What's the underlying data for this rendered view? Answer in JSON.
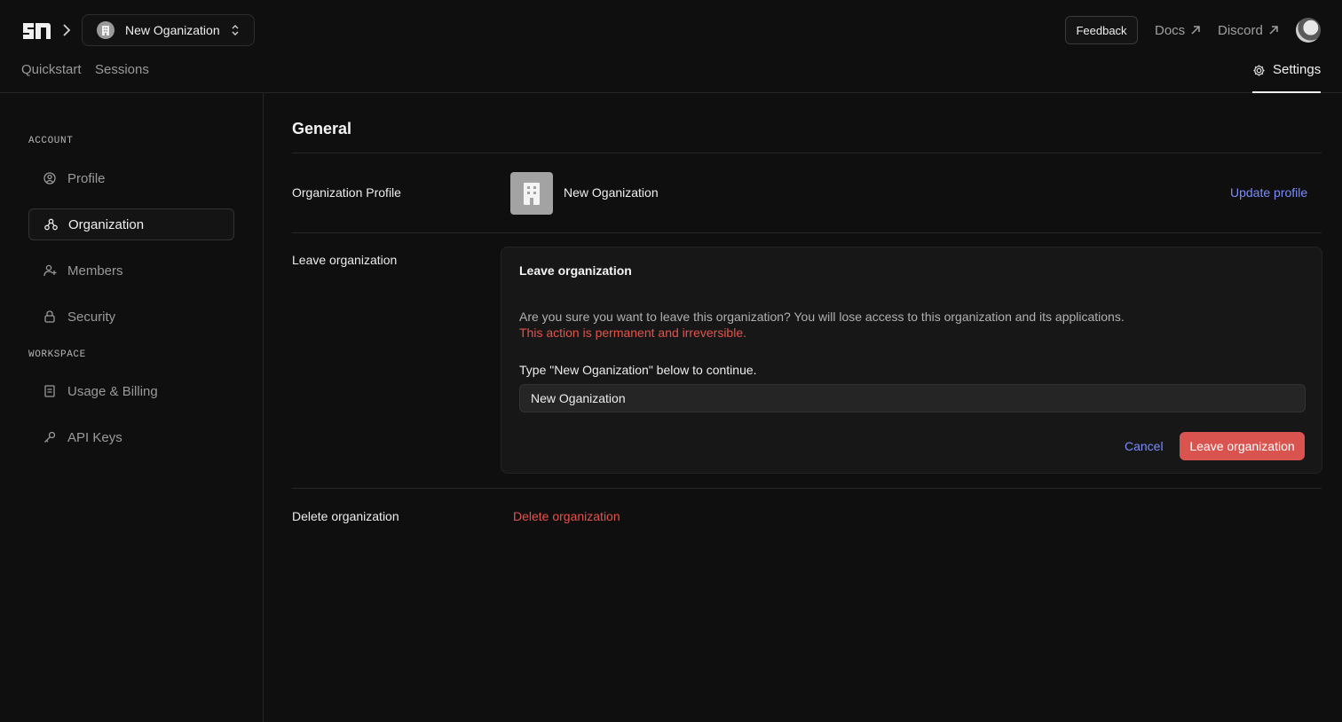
{
  "header": {
    "org_switcher": {
      "name": "New Oganization"
    },
    "feedback_label": "Feedback",
    "docs_label": "Docs",
    "discord_label": "Discord"
  },
  "nav": {
    "quickstart": "Quickstart",
    "sessions": "Sessions",
    "settings": "Settings"
  },
  "sidebar": {
    "account_label": "ACCOUNT",
    "workspace_label": "WORKSPACE",
    "items": [
      {
        "label": "Profile",
        "icon": "user-circle-icon"
      },
      {
        "label": "Organization",
        "icon": "organization-icon",
        "active": true
      },
      {
        "label": "Members",
        "icon": "user-plus-icon"
      },
      {
        "label": "Security",
        "icon": "lock-icon"
      },
      {
        "label": "Usage & Billing",
        "icon": "receipt-icon"
      },
      {
        "label": "API Keys",
        "icon": "key-icon"
      }
    ]
  },
  "main": {
    "title": "General",
    "org_profile": {
      "label": "Organization Profile",
      "name": "New Oganization",
      "update_label": "Update profile"
    },
    "leave": {
      "row_label": "Leave organization",
      "card_title": "Leave organization",
      "description": "Are you sure you want to leave this organization? You will lose access to this organization and its applications.",
      "warning": "This action is permanent and irreversible.",
      "confirm_label": "Type \"New Oganization\" below to continue.",
      "input_value": "New Oganization",
      "cancel_label": "Cancel",
      "leave_label": "Leave organization"
    },
    "delete": {
      "row_label": "Delete organization",
      "link_label": "Delete organization"
    }
  },
  "colors": {
    "background": "#0f0f0f",
    "accent": "#7b8cff",
    "danger": "#e5534b",
    "danger_button": "#d9534f"
  }
}
